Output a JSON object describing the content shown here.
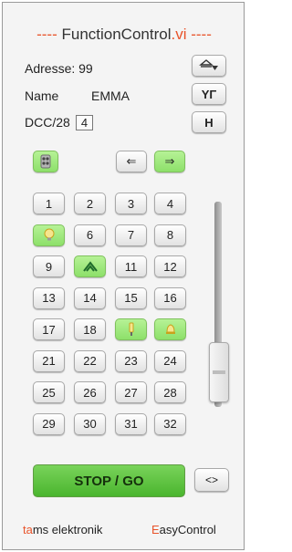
{
  "title": {
    "left_dashes": "----",
    "name": "FunctionControl",
    "ext": ".vi",
    "right_dashes": "----"
  },
  "info": {
    "address_label": "Adresse:",
    "address_value": "99",
    "name_label": "Name",
    "name_value": "EMMA",
    "dcc_label": "DCC/28",
    "dcc_value": "4"
  },
  "side_buttons": {
    "eject_icon": "eject-down-icon",
    "tool_label": "YΓ",
    "h_label": "H"
  },
  "controls": {
    "light_icon": "light-toggle-icon",
    "left_label": "⇐",
    "right_label": "⇒",
    "arrows_label": "<>",
    "stop_label": "STOP / GO"
  },
  "functions": [
    {
      "label": "1",
      "active": false
    },
    {
      "label": "2",
      "active": false
    },
    {
      "label": "3",
      "active": false
    },
    {
      "label": "4",
      "active": false
    },
    {
      "label": "",
      "active": true,
      "icon": "bulb-icon"
    },
    {
      "label": "6",
      "active": false
    },
    {
      "label": "7",
      "active": false
    },
    {
      "label": "8",
      "active": false
    },
    {
      "label": "9",
      "active": false
    },
    {
      "label": "",
      "active": true,
      "icon": "pantograph-icon"
    },
    {
      "label": "11",
      "active": false
    },
    {
      "label": "12",
      "active": false
    },
    {
      "label": "13",
      "active": false
    },
    {
      "label": "14",
      "active": false
    },
    {
      "label": "15",
      "active": false
    },
    {
      "label": "16",
      "active": false
    },
    {
      "label": "17",
      "active": false
    },
    {
      "label": "18",
      "active": false
    },
    {
      "label": "",
      "active": true,
      "icon": "signal-icon"
    },
    {
      "label": "",
      "active": true,
      "icon": "bell-icon"
    },
    {
      "label": "21",
      "active": false
    },
    {
      "label": "22",
      "active": false
    },
    {
      "label": "23",
      "active": false
    },
    {
      "label": "24",
      "active": false
    },
    {
      "label": "25",
      "active": false
    },
    {
      "label": "26",
      "active": false
    },
    {
      "label": "27",
      "active": false
    },
    {
      "label": "28",
      "active": false
    },
    {
      "label": "29",
      "active": false
    },
    {
      "label": "30",
      "active": false
    },
    {
      "label": "31",
      "active": false
    },
    {
      "label": "32",
      "active": false
    }
  ],
  "speed": {
    "level": 0.0
  },
  "footer": {
    "left_hl": "ta",
    "left_rest": "ms elektronik",
    "right_hl": "E",
    "right_rest": "asyControl"
  },
  "colors": {
    "accent": "#e8532a",
    "active_green": "#8de06a",
    "stop_green": "#4ab52e"
  }
}
